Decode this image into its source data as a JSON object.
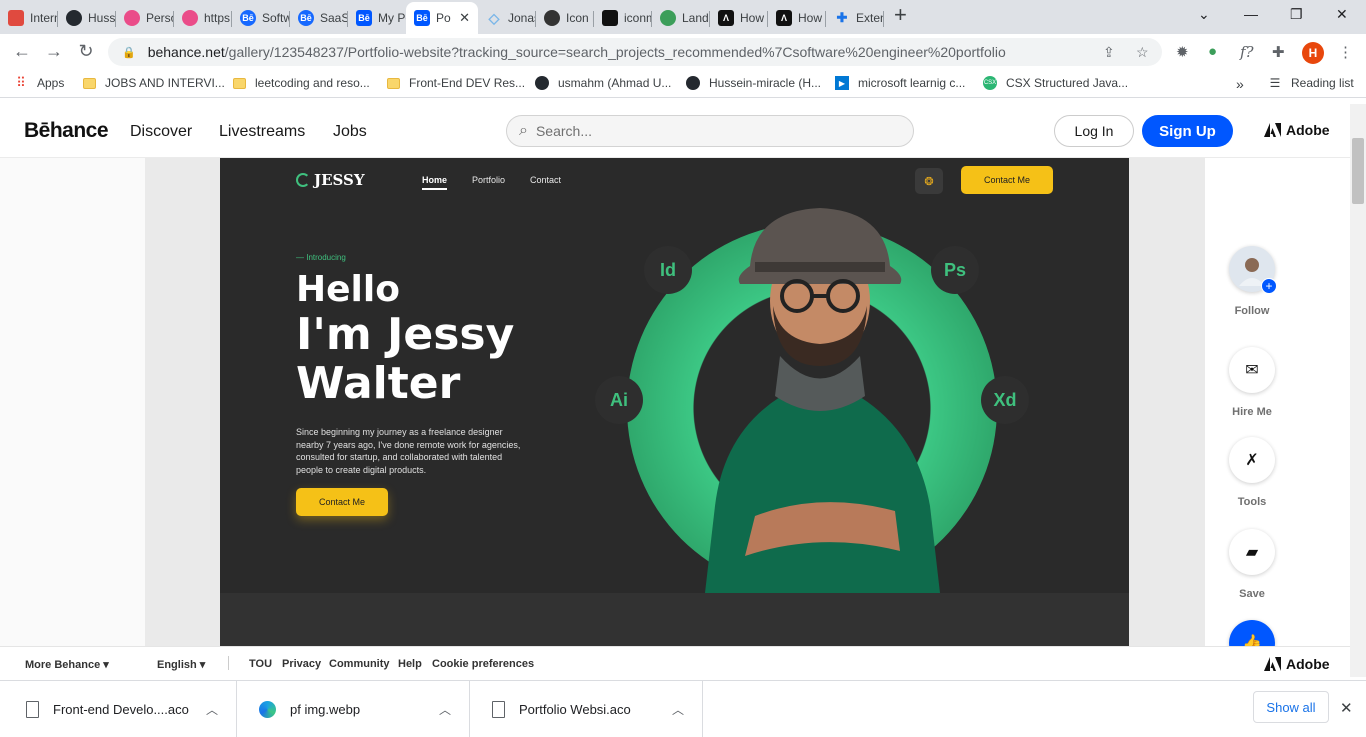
{
  "browser": {
    "tabs": [
      {
        "title": "Intern",
        "icon": "internet-icon",
        "color": "#e04a3f"
      },
      {
        "title": "Husse",
        "icon": "github-icon",
        "color": "#24292f"
      },
      {
        "title": "Person",
        "icon": "dribbble-icon",
        "color": "#ea4c89"
      },
      {
        "title": "https:",
        "icon": "dribbble-icon",
        "color": "#ea4c89"
      },
      {
        "title": "Softw",
        "icon": "behance-icon",
        "color": "#1769ff"
      },
      {
        "title": "SaaS",
        "icon": "behance-icon",
        "color": "#1769ff"
      },
      {
        "title": "My Po",
        "icon": "behance-icon",
        "color": "#0057ff"
      },
      {
        "title": "Po",
        "icon": "behance-icon",
        "color": "#0057ff",
        "active": true
      },
      {
        "title": "Jonas",
        "icon": "diamond-icon",
        "color": "#7ab6e8"
      },
      {
        "title": "Icon F",
        "icon": "iconfont-icon",
        "color": "#333333"
      },
      {
        "title": "iconm",
        "icon": "iconmonstr-icon",
        "color": "#111111"
      },
      {
        "title": "Land-",
        "icon": "globe-icon",
        "color": "#3c9e5a"
      },
      {
        "title": "How t",
        "icon": "dev-icon",
        "color": "#111111"
      },
      {
        "title": "How t",
        "icon": "dev-icon",
        "color": "#111111"
      },
      {
        "title": "Exten",
        "icon": "puzzle-icon",
        "color": "#1a73e8"
      }
    ],
    "url_host": "behance.net",
    "url_path": "/gallery/123548237/Portfolio-website?tracking_source=search_projects_recommended%7Csoftware%20engineer%20portfolio",
    "profile_initial": "H",
    "bookmarks": [
      {
        "label": "Apps",
        "icon": "apps-icon"
      },
      {
        "label": "JOBS AND INTERVI...",
        "icon": "folder-icon"
      },
      {
        "label": "leetcoding and reso...",
        "icon": "folder-icon"
      },
      {
        "label": "Front-End DEV Res...",
        "icon": "folder-icon"
      },
      {
        "label": "usmahm (Ahmad U...",
        "icon": "github-icon"
      },
      {
        "label": "Hussein-miracle (H...",
        "icon": "github-icon"
      },
      {
        "label": "microsoft learnig c...",
        "icon": "microsoft-icon"
      },
      {
        "label": "CSX Structured Java...",
        "icon": "csx-icon"
      }
    ],
    "reading_list": "Reading list",
    "more_bookmarks": "»"
  },
  "behance": {
    "logo": "Bēhance",
    "nav": [
      "Discover",
      "Livestreams",
      "Jobs"
    ],
    "search_placeholder": "Search...",
    "login": "Log In",
    "signup": "Sign Up",
    "adobe": "Adobe"
  },
  "artwork": {
    "logo": "JESSY",
    "nav": [
      "Home",
      "Portfolio",
      "Contact"
    ],
    "contact_top": "Contact Me",
    "intro": "— Introducing",
    "hello": "Hello",
    "name_line1": "I'm Jessy",
    "name_line2": "Walter",
    "bio": "Since beginning my journey as a freelance designer nearby 7 years ago, I've done remote work for agencies, consulted for startup, and collaborated with talented people to create digital products.",
    "contact_btn": "Contact Me",
    "tools": [
      "Id",
      "Ps",
      "Ai",
      "Xd"
    ],
    "accent": "#3fc07e",
    "button_color": "#f5c117"
  },
  "rail": {
    "actions": [
      "Follow",
      "Hire Me",
      "Tools",
      "Save"
    ]
  },
  "footer": {
    "more": "More Behance",
    "language": "English",
    "links": [
      "TOU",
      "Privacy",
      "Community",
      "Help",
      "Cookie preferences"
    ],
    "adobe": "Adobe"
  },
  "downloads": {
    "items": [
      {
        "name": "Front-end Develo....aco",
        "icon": "document-icon"
      },
      {
        "name": "pf img.webp",
        "icon": "edge-icon"
      },
      {
        "name": "Portfolio Websi.aco",
        "icon": "document-icon"
      }
    ],
    "show_all": "Show all"
  }
}
